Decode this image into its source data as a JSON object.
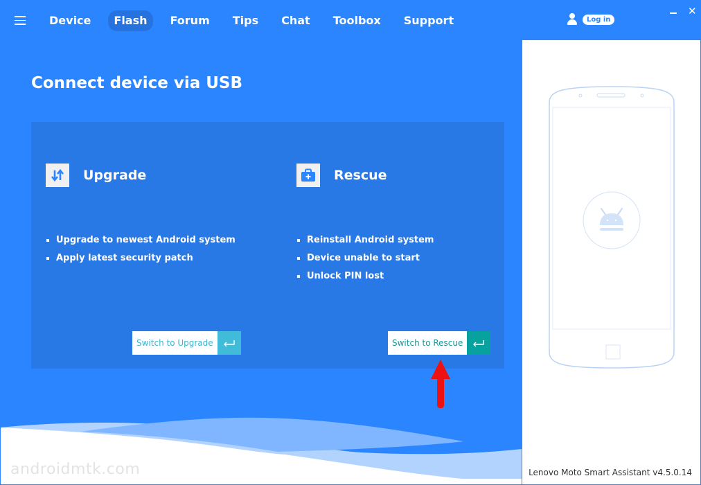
{
  "nav": {
    "menu_icon": "hamburger-icon",
    "items": [
      {
        "label": "Device",
        "active": false
      },
      {
        "label": "Flash",
        "active": true
      },
      {
        "label": "Forum",
        "active": false
      },
      {
        "label": "Tips",
        "active": false
      },
      {
        "label": "Chat",
        "active": false
      },
      {
        "label": "Toolbox",
        "active": false
      },
      {
        "label": "Support",
        "active": false
      }
    ],
    "user_icon": "user-icon",
    "login_label": "Log in",
    "minimize_icon": "minimize-icon",
    "close_label": "✕"
  },
  "main": {
    "title": "Connect device via USB",
    "modes": [
      {
        "icon": "upgrade-arrows-icon",
        "title": "Upgrade",
        "bullets": [
          "Upgrade to newest Android system",
          "Apply latest security patch"
        ],
        "button_label": "Switch to Upgrade",
        "button_color": "#40bcd8"
      },
      {
        "icon": "medical-kit-icon",
        "title": "Rescue",
        "bullets": [
          "Reinstall Android system",
          "Device unable to start",
          "Unlock PIN lost"
        ],
        "button_label": "Switch to Rescue",
        "button_color": "#08a29e"
      }
    ]
  },
  "side_panel": {
    "illustration": "phone-outline-icon",
    "screen_icon": "android-icon",
    "version_text": "Lenovo Moto Smart Assistant v4.5.0.14"
  },
  "watermark": "androidmtk.com",
  "colors": {
    "primary": "#2a85ff",
    "card": "#2878e6",
    "active_tab": "#2673e0",
    "annotation_arrow": "#ee1111"
  }
}
